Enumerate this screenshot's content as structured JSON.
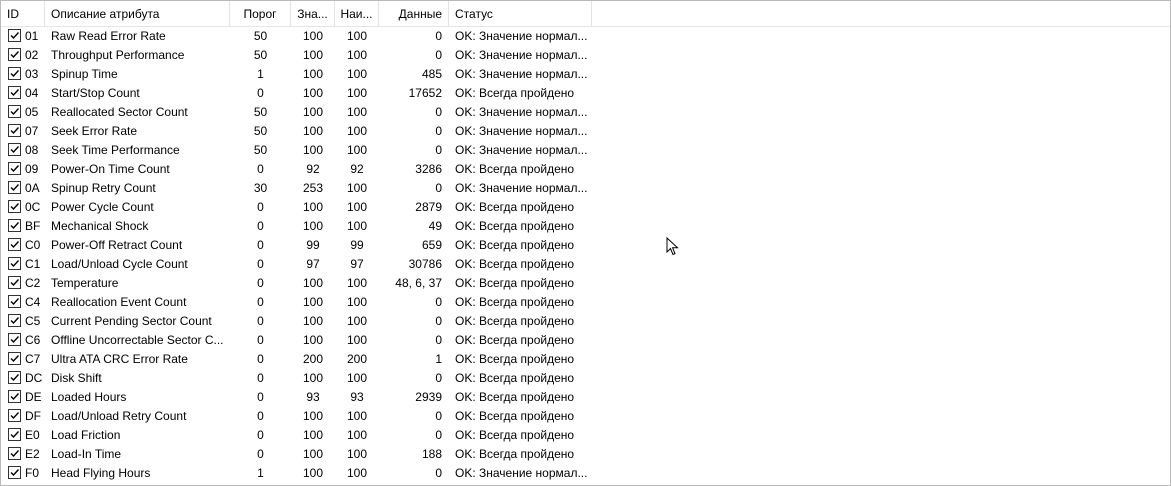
{
  "columns": {
    "id": "ID",
    "description": "Описание атрибута",
    "threshold": "Порог",
    "value": "Зна...",
    "worst": "Наи...",
    "data": "Данные",
    "status": "Статус"
  },
  "rows": [
    {
      "id": "01",
      "name": "Raw Read Error Rate",
      "threshold": "50",
      "value": "100",
      "worst": "100",
      "data": "0",
      "status": "OK: Значение нормал..."
    },
    {
      "id": "02",
      "name": "Throughput Performance",
      "threshold": "50",
      "value": "100",
      "worst": "100",
      "data": "0",
      "status": "OK: Значение нормал..."
    },
    {
      "id": "03",
      "name": "Spinup Time",
      "threshold": "1",
      "value": "100",
      "worst": "100",
      "data": "485",
      "status": "OK: Значение нормал..."
    },
    {
      "id": "04",
      "name": "Start/Stop Count",
      "threshold": "0",
      "value": "100",
      "worst": "100",
      "data": "17652",
      "status": "OK: Всегда пройдено"
    },
    {
      "id": "05",
      "name": "Reallocated Sector Count",
      "threshold": "50",
      "value": "100",
      "worst": "100",
      "data": "0",
      "status": "OK: Значение нормал..."
    },
    {
      "id": "07",
      "name": "Seek Error Rate",
      "threshold": "50",
      "value": "100",
      "worst": "100",
      "data": "0",
      "status": "OK: Значение нормал..."
    },
    {
      "id": "08",
      "name": "Seek Time Performance",
      "threshold": "50",
      "value": "100",
      "worst": "100",
      "data": "0",
      "status": "OK: Значение нормал..."
    },
    {
      "id": "09",
      "name": "Power-On Time Count",
      "threshold": "0",
      "value": "92",
      "worst": "92",
      "data": "3286",
      "status": "OK: Всегда пройдено"
    },
    {
      "id": "0A",
      "name": "Spinup Retry Count",
      "threshold": "30",
      "value": "253",
      "worst": "100",
      "data": "0",
      "status": "OK: Значение нормал..."
    },
    {
      "id": "0C",
      "name": "Power Cycle Count",
      "threshold": "0",
      "value": "100",
      "worst": "100",
      "data": "2879",
      "status": "OK: Всегда пройдено"
    },
    {
      "id": "BF",
      "name": "Mechanical Shock",
      "threshold": "0",
      "value": "100",
      "worst": "100",
      "data": "49",
      "status": "OK: Всегда пройдено"
    },
    {
      "id": "C0",
      "name": "Power-Off Retract Count",
      "threshold": "0",
      "value": "99",
      "worst": "99",
      "data": "659",
      "status": "OK: Всегда пройдено"
    },
    {
      "id": "C1",
      "name": "Load/Unload Cycle Count",
      "threshold": "0",
      "value": "97",
      "worst": "97",
      "data": "30786",
      "status": "OK: Всегда пройдено"
    },
    {
      "id": "C2",
      "name": "Temperature",
      "threshold": "0",
      "value": "100",
      "worst": "100",
      "data": "48, 6, 37",
      "status": "OK: Всегда пройдено"
    },
    {
      "id": "C4",
      "name": "Reallocation Event Count",
      "threshold": "0",
      "value": "100",
      "worst": "100",
      "data": "0",
      "status": "OK: Всегда пройдено"
    },
    {
      "id": "C5",
      "name": "Current Pending Sector Count",
      "threshold": "0",
      "value": "100",
      "worst": "100",
      "data": "0",
      "status": "OK: Всегда пройдено"
    },
    {
      "id": "C6",
      "name": "Offline Uncorrectable Sector C...",
      "threshold": "0",
      "value": "100",
      "worst": "100",
      "data": "0",
      "status": "OK: Всегда пройдено"
    },
    {
      "id": "C7",
      "name": "Ultra ATA CRC Error Rate",
      "threshold": "0",
      "value": "200",
      "worst": "200",
      "data": "1",
      "status": "OK: Всегда пройдено"
    },
    {
      "id": "DC",
      "name": "Disk Shift",
      "threshold": "0",
      "value": "100",
      "worst": "100",
      "data": "0",
      "status": "OK: Всегда пройдено"
    },
    {
      "id": "DE",
      "name": "Loaded Hours",
      "threshold": "0",
      "value": "93",
      "worst": "93",
      "data": "2939",
      "status": "OK: Всегда пройдено"
    },
    {
      "id": "DF",
      "name": "Load/Unload Retry Count",
      "threshold": "0",
      "value": "100",
      "worst": "100",
      "data": "0",
      "status": "OK: Всегда пройдено"
    },
    {
      "id": "E0",
      "name": "Load Friction",
      "threshold": "0",
      "value": "100",
      "worst": "100",
      "data": "0",
      "status": "OK: Всегда пройдено"
    },
    {
      "id": "E2",
      "name": "Load-In Time",
      "threshold": "0",
      "value": "100",
      "worst": "100",
      "data": "188",
      "status": "OK: Всегда пройдено"
    },
    {
      "id": "F0",
      "name": "Head Flying Hours",
      "threshold": "1",
      "value": "100",
      "worst": "100",
      "data": "0",
      "status": "OK: Значение нормал..."
    }
  ]
}
